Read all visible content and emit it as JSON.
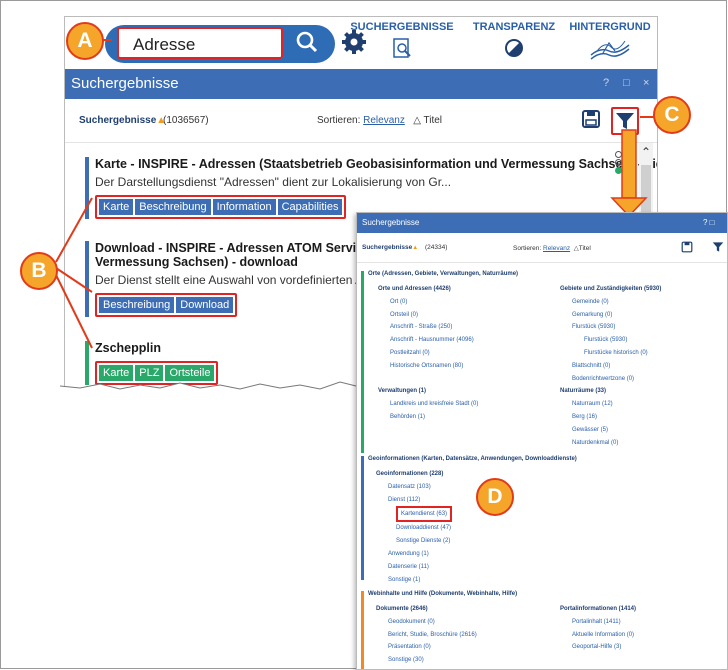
{
  "callouts": {
    "a": "A",
    "b": "B",
    "c": "C",
    "d": "D"
  },
  "search": {
    "value": "Adresse",
    "clear": "×"
  },
  "nav_tabs": [
    "SUCHERGEBNISSE",
    "TRANSPARENZ",
    "HINTERGRUND"
  ],
  "panel_title": "Suchergebnisse",
  "window_controls": {
    "help": "?",
    "maximize": "□",
    "close": "×"
  },
  "results": {
    "label": "Suchergebnisse",
    "count": "(1036567)",
    "sort_label": "Sortieren:",
    "sort_relevance": "Relevanz",
    "sort_title": "Titel",
    "sort_title_icon": "△"
  },
  "items": [
    {
      "title": "Karte - INSPIRE - Adressen (Staatsbetrieb Geobasisinformation und Vermessung Sachsen) - view",
      "desc": "Der Darstellungsdienst \"Adressen\" dient zur Lokalisierung von Gr...",
      "tags": [
        "Karte",
        "Beschreibung",
        "Information",
        "Capabilities"
      ]
    },
    {
      "title_1": "Download - INSPIRE - Adressen ATOM Service Feed",
      "title_2": "Vermessung Sachsen) - download",
      "desc": "Der Dienst stellt eine Auswahl von vordefinierten Adr",
      "tags": [
        "Beschreibung",
        "Download"
      ]
    },
    {
      "title": "Zschepplin",
      "tags": [
        "Karte",
        "PLZ",
        "Ortsteile"
      ]
    }
  ],
  "panel2": {
    "title": "Suchergebnisse",
    "controls": "? □",
    "count": "(24334)",
    "sort_label": "Sortieren:",
    "sort_relevance": "Relevanz",
    "sort_title": "Titel",
    "sort_title_icon": "△",
    "sections": [
      {
        "title": "Orte (Adressen, Gebiete, Verwaltungen, Naturräume)",
        "left": [
          {
            "t": "Orte und Adressen (4426)",
            "k": "h"
          },
          {
            "t": "Ort (0)",
            "k": "i"
          },
          {
            "t": "Ortsteil (0)",
            "k": "i"
          },
          {
            "t": "Anschrift - Straße (250)",
            "k": "i"
          },
          {
            "t": "Anschrift - Hausnummer (4096)",
            "k": "i"
          },
          {
            "t": "Postleitzahl (0)",
            "k": "i"
          },
          {
            "t": "Historische Ortsnamen (80)",
            "k": "i"
          },
          {
            "t": "",
            "k": "i"
          },
          {
            "t": "Verwaltungen (1)",
            "k": "h"
          },
          {
            "t": "Landkreis und kreisfreie Stadt (0)",
            "k": "i"
          },
          {
            "t": "Behörden (1)",
            "k": "i"
          }
        ],
        "right": [
          {
            "t": "Gebiete und Zuständigkeiten (5930)",
            "k": "h"
          },
          {
            "t": "Gemeinde (0)",
            "k": "i"
          },
          {
            "t": "Gemarkung (0)",
            "k": "i"
          },
          {
            "t": "Flurstück (5930)",
            "k": "i"
          },
          {
            "t": "Flurstück (5930)",
            "k": "i"
          },
          {
            "t": "Flurstücke historisch (0)",
            "k": "i"
          },
          {
            "t": "Blattschnitt (0)",
            "k": "i"
          },
          {
            "t": "Bodenrichtwertzone (0)",
            "k": "i"
          },
          {
            "t": "Naturräume (33)",
            "k": "h"
          },
          {
            "t": "Naturraum (12)",
            "k": "i"
          },
          {
            "t": "Berg (16)",
            "k": "i"
          },
          {
            "t": "Gewässer (5)",
            "k": "i"
          },
          {
            "t": "Naturdenkmal (0)",
            "k": "i"
          }
        ]
      },
      {
        "title": "Geoinformationen (Karten, Datensätze, Anwendungen, Downloaddienste)",
        "left": [
          {
            "t": "Geoinformationen (228)",
            "k": "h"
          },
          {
            "t": "Datensatz (103)",
            "k": "i"
          },
          {
            "t": "Dienst (112)",
            "k": "i"
          },
          {
            "t": "Kartendienst (63)",
            "k": "i"
          },
          {
            "t": "Downloaddienst (47)",
            "k": "i"
          },
          {
            "t": "Sonstige Dienste (2)",
            "k": "i"
          },
          {
            "t": "Anwendung (1)",
            "k": "i"
          },
          {
            "t": "Datenserie (11)",
            "k": "i"
          },
          {
            "t": "Sonstige (1)",
            "k": "i"
          }
        ]
      },
      {
        "title": "Webinhalte und Hilfe (Dokumente, Webinhalte, Hilfe)",
        "left": [
          {
            "t": "Dokumente (2646)",
            "k": "h"
          },
          {
            "t": "Geodokument (0)",
            "k": "i"
          },
          {
            "t": "Bericht, Studie, Broschüre (2616)",
            "k": "i"
          },
          {
            "t": "Präsentation (0)",
            "k": "i"
          },
          {
            "t": "Sonstige (30)",
            "k": "i"
          }
        ],
        "right": [
          {
            "t": "Portalinformationen (1414)",
            "k": "h"
          },
          {
            "t": "Portalinhalt (1411)",
            "k": "i"
          },
          {
            "t": "Aktuelle Information (0)",
            "k": "i"
          },
          {
            "t": "Geoportal-Hilfe (3)",
            "k": "i"
          }
        ]
      }
    ]
  },
  "colors": {
    "accent": "#3d6eb5",
    "highlight": "#e02424",
    "callout": "#f5a52a",
    "green": "#2aa86a",
    "orange": "#f08a24"
  }
}
